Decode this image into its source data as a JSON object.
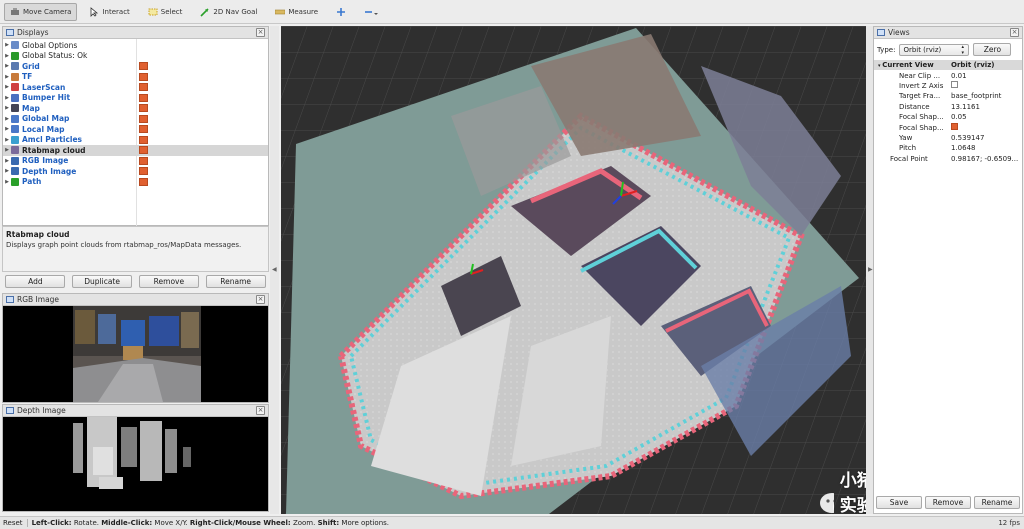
{
  "toolbar": {
    "tools": [
      {
        "label": "Move Camera",
        "icon": "move-camera-icon"
      },
      {
        "label": "Interact",
        "icon": "interact-icon"
      },
      {
        "label": "Select",
        "icon": "select-icon"
      },
      {
        "label": "2D Nav Goal",
        "icon": "nav-goal-icon"
      },
      {
        "label": "Measure",
        "icon": "measure-icon"
      }
    ],
    "extra_icons": [
      "add-icon",
      "minus-icon"
    ]
  },
  "displays": {
    "title": "Displays",
    "items": [
      {
        "label": "Global Options",
        "icon": "gear-icon",
        "checked": null,
        "style": "plain"
      },
      {
        "label": "Global Status: Ok",
        "icon": "check-icon",
        "checked": null,
        "style": "plain"
      },
      {
        "label": "Grid",
        "icon": "grid-icon",
        "checked": true,
        "style": "blue"
      },
      {
        "label": "TF",
        "icon": "tf-icon",
        "checked": true,
        "style": "blue"
      },
      {
        "label": "LaserScan",
        "icon": "laserscan-icon",
        "checked": true,
        "style": "blue"
      },
      {
        "label": "Bumper Hit",
        "icon": "pointcloud-icon",
        "checked": true,
        "style": "blue"
      },
      {
        "label": "Map",
        "icon": "map-icon",
        "checked": true,
        "style": "blue"
      },
      {
        "label": "Global Map",
        "icon": "folder-icon",
        "checked": true,
        "style": "blue"
      },
      {
        "label": "Local Map",
        "icon": "folder-icon",
        "checked": true,
        "style": "blue"
      },
      {
        "label": "Amcl Particles",
        "icon": "particles-icon",
        "checked": true,
        "style": "blue"
      },
      {
        "label": "Rtabmap cloud",
        "icon": "cloud-icon",
        "checked": true,
        "style": "selected"
      },
      {
        "label": "RGB Image",
        "icon": "image-icon",
        "checked": true,
        "style": "blue"
      },
      {
        "label": "Depth Image",
        "icon": "image-icon",
        "checked": true,
        "style": "blue"
      },
      {
        "label": "Path",
        "icon": "path-icon",
        "checked": true,
        "style": "blue"
      }
    ]
  },
  "description": {
    "title": "Rtabmap cloud",
    "text": "Displays graph point clouds from rtabmap_ros/MapData messages."
  },
  "display_buttons": {
    "add": "Add",
    "duplicate": "Duplicate",
    "remove": "Remove",
    "rename": "Rename"
  },
  "rgb_panel": {
    "title": "RGB Image"
  },
  "depth_panel": {
    "title": "Depth Image"
  },
  "views": {
    "title": "Views",
    "type_label": "Type:",
    "type_value": "Orbit (rviz)",
    "zero_label": "Zero",
    "header": {
      "key": "Current View",
      "value": "Orbit (rviz)"
    },
    "props": [
      {
        "key": "Near Clip ...",
        "value": "0.01"
      },
      {
        "key": "Invert Z Axis",
        "value": ""
      },
      {
        "key": "Target Fra...",
        "value": "base_footprint"
      },
      {
        "key": "Distance",
        "value": "13.1161"
      },
      {
        "key": "Focal Shap...",
        "value": "0.05"
      },
      {
        "key": "Focal Shap...",
        "value": ""
      },
      {
        "key": "Yaw",
        "value": "0.539147"
      },
      {
        "key": "Pitch",
        "value": "1.0648"
      },
      {
        "key": "Focal Point",
        "value": "0.98167; -0.6509..."
      }
    ],
    "buttons": {
      "save": "Save",
      "remove": "Remove",
      "rename": "Rename"
    }
  },
  "status": {
    "reset": "Reset",
    "hint_parts": [
      {
        "bold": "Left-Click:",
        "text": " Rotate. "
      },
      {
        "bold": "Middle-Click:",
        "text": " Move X/Y. "
      },
      {
        "bold": "Right-Click/Mouse Wheel:",
        "text": " Zoom. "
      },
      {
        "bold": "Shift:",
        "text": " More options."
      }
    ],
    "fps": "12 fps"
  },
  "watermark": {
    "text": "小猪实验室"
  },
  "colors": {
    "accent_blue": "#1f5fbf",
    "checkbox_orange": "#e06030",
    "scene_bg": "#2f2f2f",
    "map_floor": "#c9c9c9",
    "costmap_pink": "#e8657a",
    "costmap_cyan": "#5fd0d8",
    "grid_plane": "#7f9b96"
  }
}
